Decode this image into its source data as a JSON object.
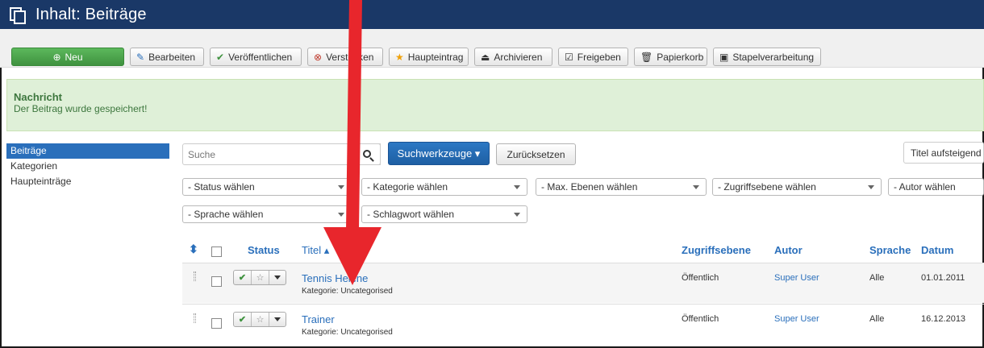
{
  "header": {
    "title": "Inhalt: Beiträge",
    "icon": "copy-icon"
  },
  "toolbar": {
    "new": "Neu",
    "edit": "Bearbeiten",
    "publish": "Veröffentlichen",
    "unpublish": "Verstecken",
    "feature": "Haupteintrag",
    "archive": "Archivieren",
    "checkin": "Freigeben",
    "trash": "Papierkorb",
    "batch": "Stapelverarbeitung"
  },
  "message": {
    "heading": "Nachricht",
    "text": "Der Beitrag wurde gespeichert!"
  },
  "sidebar": {
    "items": [
      {
        "label": "Beiträge",
        "active": true
      },
      {
        "label": "Kategorien",
        "active": false
      },
      {
        "label": "Haupteinträge",
        "active": false
      }
    ]
  },
  "search": {
    "placeholder": "Suche",
    "tools_label": "Suchwerkzeuge ▾",
    "reset_label": "Zurücksetzen",
    "sort_label": "Titel aufsteigend"
  },
  "filters": {
    "status": "- Status wählen",
    "category": "- Kategorie wählen",
    "levels": "- Max. Ebenen wählen",
    "access": "- Zugriffsebene wählen",
    "author": "- Autor wählen",
    "language": "- Sprache wählen",
    "tag": "- Schlagwort wählen"
  },
  "table": {
    "headers": {
      "sort": "⬍",
      "status": "Status",
      "title": "Titel ▴",
      "access": "Zugriffsebene",
      "author": "Autor",
      "language": "Sprache",
      "date": "Datum"
    },
    "rows": [
      {
        "title": "Tennis Helene",
        "category": "Kategorie: Uncategorised",
        "access": "Öffentlich",
        "author": "Super User",
        "language": "Alle",
        "date": "01.01.2011"
      },
      {
        "title": "Trainer",
        "category": "Kategorie: Uncategorised",
        "access": "Öffentlich",
        "author": "Super User",
        "language": "Alle",
        "date": "16.12.2013"
      }
    ]
  },
  "colors": {
    "header_bg": "#1a3867",
    "accent": "#2a6fbb",
    "success_bg": "#dff0d8",
    "annotation_arrow": "#e8262c"
  }
}
